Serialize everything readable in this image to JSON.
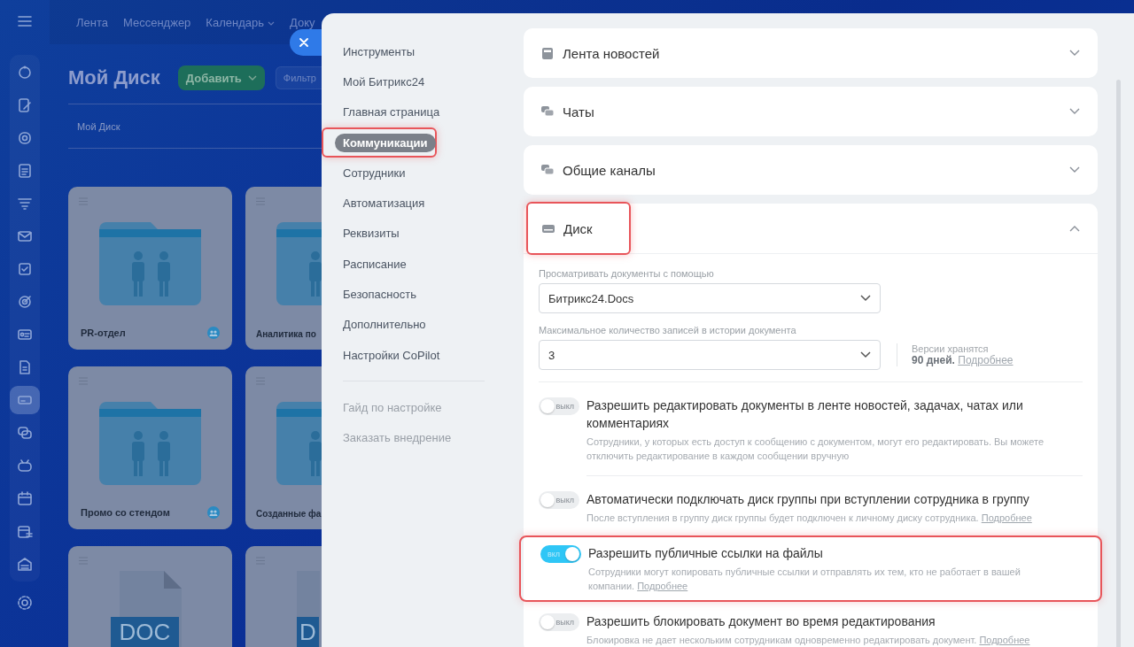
{
  "sidebar": {
    "items": [
      {
        "selected": false
      },
      {
        "selected": false
      },
      {
        "selected": false
      },
      {
        "selected": false
      },
      {
        "selected": false
      },
      {
        "selected": false
      },
      {
        "selected": false
      },
      {
        "selected": false
      },
      {
        "selected": false
      },
      {
        "selected": false
      },
      {
        "selected": true
      },
      {
        "selected": false
      },
      {
        "selected": false
      },
      {
        "selected": false
      },
      {
        "selected": false
      },
      {
        "selected": false
      }
    ]
  },
  "topbar": {
    "links": [
      {
        "label": "Лента",
        "dropdown": false
      },
      {
        "label": "Мессенджер",
        "dropdown": false
      },
      {
        "label": "Календарь",
        "dropdown": true
      },
      {
        "label": "Доку",
        "dropdown": false
      }
    ]
  },
  "page": {
    "title": "Мой Диск",
    "add_button": "Добавить",
    "filter_placeholder": "Фильтр",
    "breadcrumb": "Мой Диск",
    "files": [
      {
        "kind": "folder",
        "name": "PR-отдел",
        "shared": true
      },
      {
        "kind": "folder",
        "name": "Аналитика по",
        "shared": false
      },
      {
        "kind": "folder",
        "name": "Промо со стендом",
        "shared": true
      },
      {
        "kind": "folder",
        "name": "Созданные фа",
        "shared": false
      },
      {
        "kind": "doc",
        "label": "DOC"
      },
      {
        "kind": "doc",
        "label": "D"
      }
    ]
  },
  "settings": {
    "nav": [
      {
        "label": "Инструменты",
        "selected": false,
        "highlighted": false
      },
      {
        "label": "Мой Битрикс24",
        "selected": false,
        "highlighted": false
      },
      {
        "label": "Главная страница",
        "selected": false,
        "highlighted": false
      },
      {
        "label": "Коммуникации",
        "selected": true,
        "highlighted": true
      },
      {
        "label": "Сотрудники",
        "selected": false,
        "highlighted": false
      },
      {
        "label": "Автоматизация",
        "selected": false,
        "highlighted": false
      },
      {
        "label": "Реквизиты",
        "selected": false,
        "highlighted": false
      },
      {
        "label": "Расписание",
        "selected": false,
        "highlighted": false
      },
      {
        "label": "Безопасность",
        "selected": false,
        "highlighted": false
      },
      {
        "label": "Дополнительно",
        "selected": false,
        "highlighted": false
      },
      {
        "label": "Настройки CoPilot",
        "selected": false,
        "highlighted": false
      }
    ],
    "nav_extra": [
      "Гайд по настройке",
      "Заказать внедрение"
    ],
    "sections": [
      {
        "kind": "news",
        "title": "Лента новостей",
        "expanded": false,
        "highlighted": false
      },
      {
        "kind": "chat",
        "title": "Чаты",
        "expanded": false,
        "highlighted": false
      },
      {
        "kind": "chat",
        "title": "Общие каналы",
        "expanded": false,
        "highlighted": false
      },
      {
        "kind": "disk",
        "title": "Диск",
        "expanded": true,
        "highlighted": true,
        "fields": [
          {
            "label": "Просматривать документы с помощью",
            "value": "Битрикс24.Docs"
          },
          {
            "label": "Максимальное количество записей в истории документа",
            "value": "3",
            "note": "Версии хранятся",
            "note_value": "90 дней.",
            "note_link": "Подробнее"
          }
        ],
        "options": [
          {
            "on": false,
            "toggle_label": "выкл",
            "title": "Разрешить редактировать документы в ленте новостей, задачах, чатах или комментариях",
            "description": "Сотрудники, у которых есть доступ к сообщению с документом, могут его редактировать. Вы можете отключить редактирование в каждом сообщении вручную",
            "highlighted": false
          },
          {
            "on": false,
            "toggle_label": "выкл",
            "title": "Автоматически подключать диск группы при вступлении сотрудника в группу",
            "description": "После вступления в группу диск группы будет подключен к личному диску сотрудника.",
            "link": "Подробнее",
            "highlighted": false
          },
          {
            "on": true,
            "toggle_label": "вкл",
            "title": "Разрешить публичные ссылки на файлы",
            "description": "Сотрудники могут копировать публичные ссылки и отправлять их тем, кто не работает в вашей компании.",
            "link": "Подробнее",
            "highlighted": true
          },
          {
            "on": false,
            "toggle_label": "выкл",
            "title": "Разрешить блокировать документ во время редактирования",
            "description": "Блокировка не дает нескольким сотрудникам одновременно редактировать документ.",
            "link": "Подробнее",
            "highlighted": false
          }
        ]
      }
    ]
  }
}
